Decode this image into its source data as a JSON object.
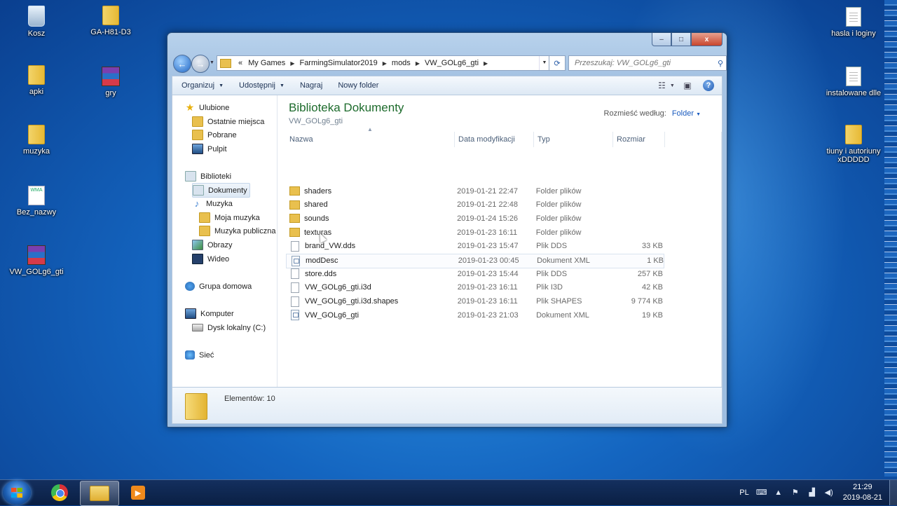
{
  "desktop": {
    "icons": [
      {
        "label": "Kosz",
        "icon": "recycle-bin-icon"
      },
      {
        "label": "GA-H81-D3",
        "icon": "folder-icon"
      },
      {
        "label": "apki",
        "icon": "folder-icon"
      },
      {
        "label": "gry",
        "icon": "winrar-icon"
      },
      {
        "label": "muzyka",
        "icon": "folder-icon"
      },
      {
        "label": "Bez_nazwy",
        "icon": "wma-file-icon",
        "badge": "WMA"
      },
      {
        "label": "VW_GOLg6_gti",
        "icon": "winrar-icon"
      },
      {
        "label": "hasla i loginy",
        "icon": "text-file-icon"
      },
      {
        "label": "instalowane dlle",
        "icon": "text-file-icon"
      },
      {
        "label": "tiuny i autoriuny xDDDDD",
        "icon": "folder-icon"
      }
    ]
  },
  "window": {
    "controls": {
      "minimize": "–",
      "maximize": "□",
      "close": "x"
    },
    "address": {
      "prefix": "«",
      "crumbs": [
        "My Games",
        "FarmingSimulator2019",
        "mods",
        "VW_GOLg6_gti"
      ]
    },
    "search_placeholder": "Przeszukaj: VW_GOLg6_gti",
    "toolbar": {
      "organize": "Organizuj",
      "share": "Udostępnij",
      "burn": "Nagraj",
      "new_folder": "Nowy folder"
    },
    "nav": {
      "favorites": "Ulubione",
      "recent": "Ostatnie miejsca",
      "downloads": "Pobrane",
      "desktop": "Pulpit",
      "libraries": "Biblioteki",
      "documents": "Dokumenty",
      "music": "Muzyka",
      "my_music": "Moja muzyka",
      "public_music": "Muzyka publiczna",
      "pictures": "Obrazy",
      "videos": "Wideo",
      "homegroup": "Grupa domowa",
      "computer": "Komputer",
      "local_disk": "Dysk lokalny (C:)",
      "network": "Sieć"
    },
    "library_title": "Biblioteka Dokumenty",
    "library_subtitle": "VW_GOLg6_gti",
    "arrange_label": "Rozmieść według:",
    "arrange_value": "Folder",
    "columns": {
      "name": "Nazwa",
      "date": "Data modyfikacji",
      "type": "Typ",
      "size": "Rozmiar"
    },
    "files": [
      {
        "name": "shaders",
        "date": "2019-01-21 22:47",
        "type": "Folder plików",
        "size": "",
        "kind": "folder"
      },
      {
        "name": "shared",
        "date": "2019-01-21 22:48",
        "type": "Folder plików",
        "size": "",
        "kind": "folder"
      },
      {
        "name": "sounds",
        "date": "2019-01-24 15:26",
        "type": "Folder plików",
        "size": "",
        "kind": "folder"
      },
      {
        "name": "texturas",
        "date": "2019-01-23 16:11",
        "type": "Folder plików",
        "size": "",
        "kind": "folder"
      },
      {
        "name": "brand_VW.dds",
        "date": "2019-01-23 15:47",
        "type": "Plik DDS",
        "size": "33 KB",
        "kind": "file"
      },
      {
        "name": "modDesc",
        "date": "2019-01-23 00:45",
        "type": "Dokument XML",
        "size": "1 KB",
        "kind": "xml"
      },
      {
        "name": "store.dds",
        "date": "2019-01-23 15:44",
        "type": "Plik DDS",
        "size": "257 KB",
        "kind": "file"
      },
      {
        "name": "VW_GOLg6_gti.i3d",
        "date": "2019-01-23 16:11",
        "type": "Plik I3D",
        "size": "42 KB",
        "kind": "file"
      },
      {
        "name": "VW_GOLg6_gti.i3d.shapes",
        "date": "2019-01-23 16:11",
        "type": "Plik SHAPES",
        "size": "9 774 KB",
        "kind": "file"
      },
      {
        "name": "VW_GOLg6_gti",
        "date": "2019-01-23 21:03",
        "type": "Dokument XML",
        "size": "19 KB",
        "kind": "xml"
      }
    ],
    "status": "Elementów: 10"
  },
  "taskbar": {
    "language": "PL",
    "time": "21:29",
    "date": "2019-08-21"
  }
}
